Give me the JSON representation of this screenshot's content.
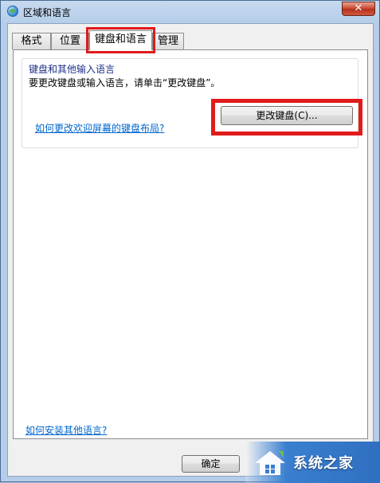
{
  "window": {
    "title": "区域和语言",
    "close_symbol": "✕"
  },
  "tabs": [
    {
      "label": "格式"
    },
    {
      "label": "位置"
    },
    {
      "label": "键盘和语言",
      "selected": true
    },
    {
      "label": "管理"
    }
  ],
  "keyboard_group": {
    "title": "键盘和其他输入语言",
    "description": "要更改键盘或输入语言，请单击“更改键盘”。",
    "change_keyboard_button": "更改键盘(C)..."
  },
  "links": {
    "welcome_layout": "如何更改欢迎屏幕的键盘布局?",
    "install_languages": "如何安装其他语言?"
  },
  "buttons": {
    "ok": "确定"
  },
  "watermark": {
    "text": "系统之家"
  },
  "colors": {
    "highlight": "#e11b1b",
    "link": "#0066cc"
  }
}
